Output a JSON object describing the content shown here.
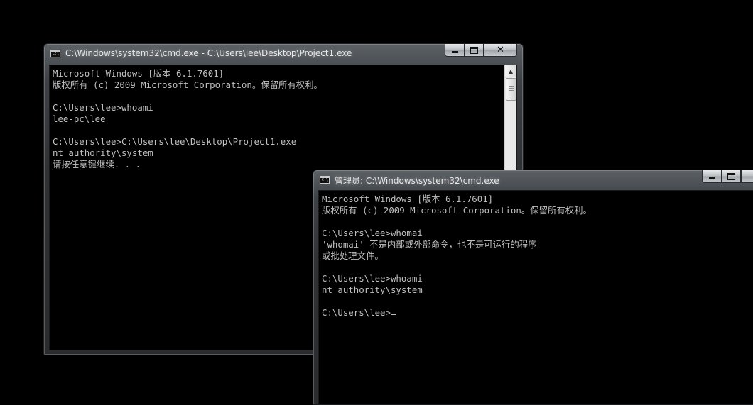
{
  "window1": {
    "title": "C:\\Windows\\system32\\cmd.exe - C:\\Users\\lee\\Desktop\\Project1.exe",
    "icon_text": "C:\\",
    "lines": [
      "Microsoft Windows [版本 6.1.7601]",
      "版权所有 (c) 2009 Microsoft Corporation。保留所有权利。",
      "",
      "C:\\Users\\lee>whoami",
      "lee-pc\\lee",
      "",
      "C:\\Users\\lee>C:\\Users\\lee\\Desktop\\Project1.exe",
      "nt authority\\system",
      "请按任意键继续. . ."
    ],
    "controls": [
      "minimize-icon",
      "maximize-icon",
      "close-icon"
    ]
  },
  "window2": {
    "title": "管理员: C:\\Windows\\system32\\cmd.exe",
    "icon_text": "C:\\",
    "lines": [
      "Microsoft Windows [版本 6.1.7601]",
      "版权所有 (c) 2009 Microsoft Corporation。保留所有权利。",
      "",
      "C:\\Users\\lee>whomai",
      "'whomai' 不是内部或外部命令，也不是可运行的程序",
      "或批处理文件。",
      "",
      "C:\\Users\\lee>whoami",
      "nt authority\\system",
      ""
    ],
    "prompt": "C:\\Users\\lee>",
    "controls": [
      "minimize-icon",
      "maximize-icon"
    ]
  },
  "colors": {
    "console_bg": "#000000",
    "console_text": "#c0c0c0",
    "frame": "#3d4145"
  },
  "icons": {
    "scroll_up": "▲",
    "scroll_down": "▼",
    "close": "✕"
  }
}
